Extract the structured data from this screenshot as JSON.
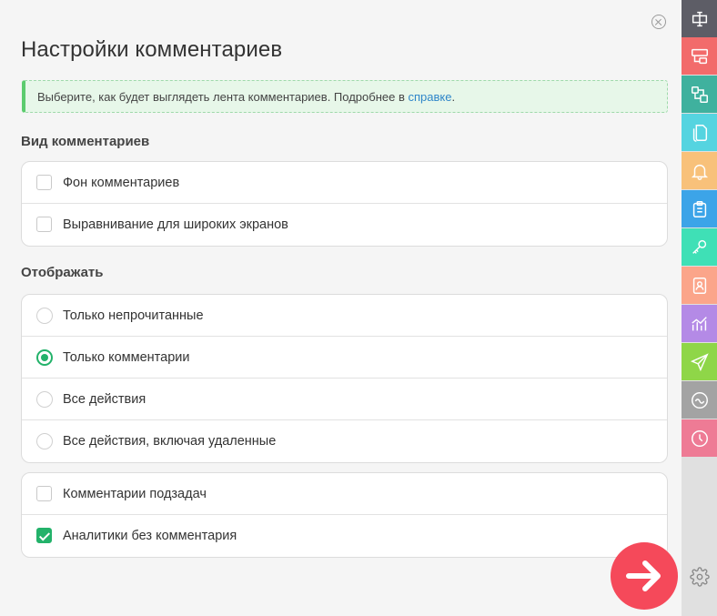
{
  "panel": {
    "title": "Настройки комментариев",
    "info": {
      "text": "Выберите, как будет выглядеть лента комментариев. Подробнее в ",
      "link": "справке",
      "end": "."
    }
  },
  "view_section": {
    "label": "Вид комментариев",
    "items": [
      {
        "label": "Фон комментариев",
        "checked": false
      },
      {
        "label": "Выравнивание для широких экранов",
        "checked": false
      }
    ]
  },
  "display_section": {
    "label": "Отображать",
    "options": [
      {
        "label": "Только непрочитанные",
        "selected": false
      },
      {
        "label": "Только комментарии",
        "selected": true
      },
      {
        "label": "Все действия",
        "selected": false
      },
      {
        "label": "Все действия, включая удаленные",
        "selected": false
      }
    ]
  },
  "extra_section": {
    "items": [
      {
        "label": "Комментарии подзадач",
        "checked": false
      },
      {
        "label": "Аналитики без комментария",
        "checked": true
      }
    ]
  },
  "sidebar": {
    "items": [
      {
        "icon": "text-cursor-icon",
        "color": "#5d5d66"
      },
      {
        "icon": "layout-icon",
        "color": "#f26b6b"
      },
      {
        "icon": "structure-icon",
        "color": "#3fb19e"
      },
      {
        "icon": "documents-icon",
        "color": "#55d4e0"
      },
      {
        "icon": "bell-icon",
        "color": "#f8c17a"
      },
      {
        "icon": "clipboard-icon",
        "color": "#3ca4e8"
      },
      {
        "icon": "key-icon",
        "color": "#3fe0b6"
      },
      {
        "icon": "contact-icon",
        "color": "#fba58a"
      },
      {
        "icon": "analytics-icon",
        "color": "#b48ae6"
      },
      {
        "icon": "paper-plane-icon",
        "color": "#8fd648"
      },
      {
        "icon": "wave-icon",
        "color": "#a3a3a3"
      },
      {
        "icon": "clock-icon",
        "color": "#ee7b95"
      }
    ],
    "settings_icon": "gear-icon"
  },
  "fab": {
    "icon": "arrow-right-icon",
    "color": "#f5495a"
  }
}
